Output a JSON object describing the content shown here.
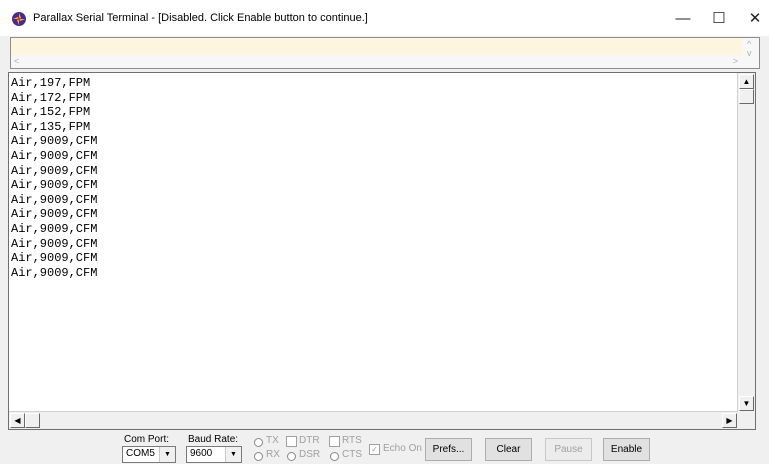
{
  "window": {
    "title": "Parallax Serial Terminal - [Disabled. Click Enable button to continue.]",
    "minimize": "—",
    "maximize": "☐",
    "close": "✕",
    "icon": "propeller-icon"
  },
  "transmit": {
    "value": "",
    "scroll_up": "^",
    "scroll_down": "v",
    "scroll_left": "<",
    "scroll_right": ">"
  },
  "receive": {
    "lines": [
      "Air,197,FPM",
      "Air,172,FPM",
      "Air,152,FPM",
      "Air,135,FPM",
      "Air,9009,CFM",
      "Air,9009,CFM",
      "Air,9009,CFM",
      "Air,9009,CFM",
      "Air,9009,CFM",
      "Air,9009,CFM",
      "Air,9009,CFM",
      "Air,9009,CFM",
      "Air,9009,CFM",
      "Air,9009,CFM"
    ]
  },
  "controls": {
    "com_port_label": "Com Port:",
    "com_port_value": "COM5",
    "baud_rate_label": "Baud Rate:",
    "baud_rate_value": "9600",
    "tx_label": "TX",
    "rx_label": "RX",
    "dtr_label": "DTR",
    "dsr_label": "DSR",
    "rts_label": "RTS",
    "cts_label": "CTS",
    "echo_label": "Echo On",
    "echo_checked": true,
    "prefs_label": "Prefs...",
    "clear_label": "Clear",
    "pause_label": "Pause",
    "enable_label": "Enable"
  }
}
